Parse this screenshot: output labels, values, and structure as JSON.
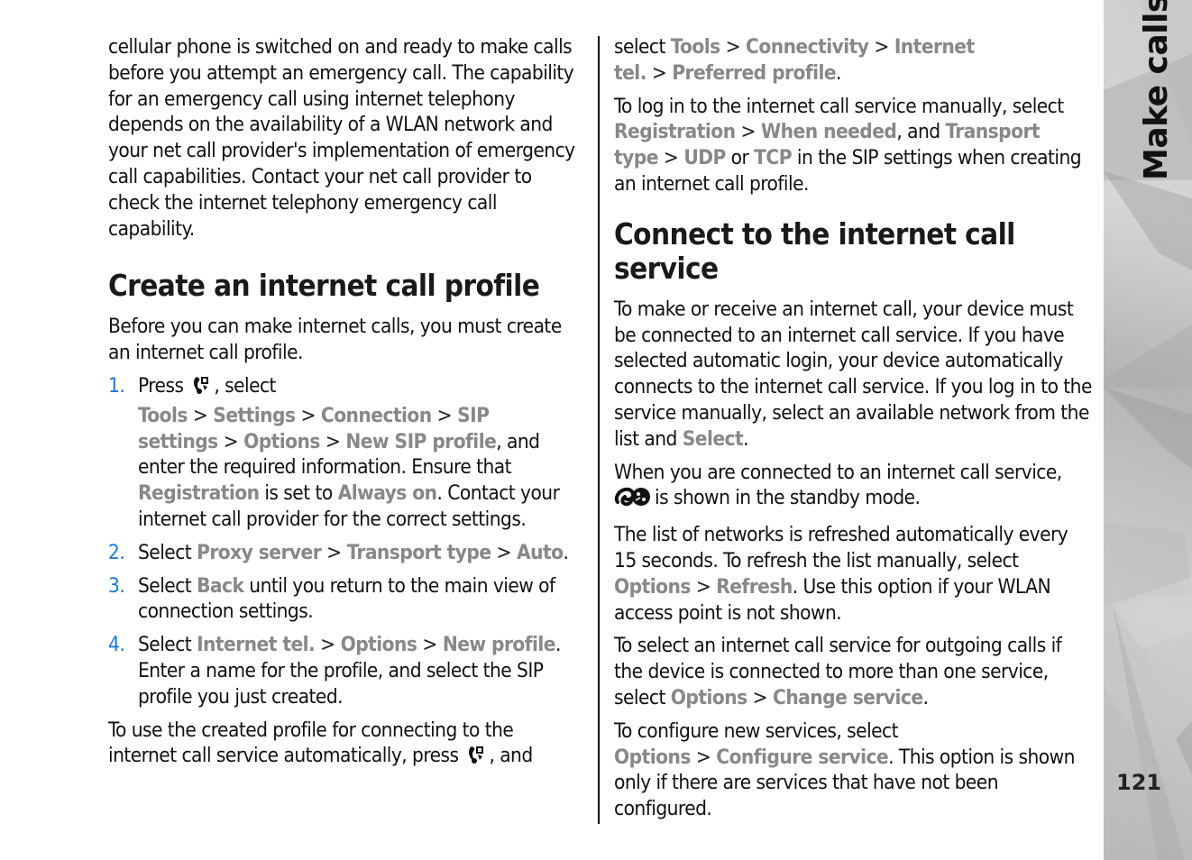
{
  "side_tab": {
    "title": "Make calls",
    "page_number": "121"
  },
  "left": {
    "intro": "cellular phone is switched on and ready to make calls before you attempt an emergency call. The capability for an emergency call using internet telephony depends on the availability of a WLAN network and your net call provider's implementation of emergency call capabilities. Contact your net call provider to check the internet telephony emergency call capability.",
    "heading": "Create an internet call profile",
    "lead": "Before you can make internet calls, you must create an internet call profile.",
    "steps": [
      {
        "num": "1.",
        "t1": "Press",
        "t2": ", select",
        "k1": "Tools",
        "k2": "Settings",
        "k3": "Connection",
        "k4": "SIP settings",
        "k5": "Options",
        "k6": "New SIP profile",
        "t3": ", and enter the required information. Ensure that",
        "k7": "Registration",
        "t4": "is set to",
        "k8": "Always on",
        "t5": ". Contact your internet call provider for the correct settings."
      },
      {
        "num": "2.",
        "t1": "Select",
        "k1": "Proxy server",
        "k2": "Transport type",
        "k3": "Auto",
        "t2": "."
      },
      {
        "num": "3.",
        "t1": "Select",
        "k1": "Back",
        "t2": "until you return to the main view of connection settings."
      },
      {
        "num": "4.",
        "t1": "Select",
        "k1": "Internet tel.",
        "k2": "Options",
        "k3": "New profile",
        "t2": ". Enter a name for the profile, and select the SIP profile you just created."
      }
    ],
    "outro_1": "To use the created profile for connecting to the internet call service automatically, press",
    "outro_2": ", and"
  },
  "right": {
    "p1": {
      "t1": "select",
      "k1": "Tools",
      "k2": "Connectivity",
      "k3": "Internet tel.",
      "k4": "Preferred profile",
      "t2": "."
    },
    "p2": {
      "t1": "To log in to the internet call service manually, select",
      "k1": "Registration",
      "k2": "When needed",
      "t2": ", and",
      "k3": "Transport type",
      "k4": "UDP",
      "t3": "or",
      "k5": "TCP",
      "t4": "in the SIP settings when creating an internet call profile."
    },
    "heading": "Connect to the internet call service",
    "p3": {
      "t1": "To make or receive an internet call, your device must be connected to an internet call service. If you have selected automatic login, your device automatically connects to the internet call service. If you log in to the service manually, select an available network from the list and",
      "k1": "Select",
      "t2": "."
    },
    "p4": {
      "t1": "When you are connected to an internet call service,",
      "t2": "is shown in the standby mode."
    },
    "p5": {
      "t1": "The list of networks is refreshed automatically every 15 seconds. To refresh the list manually, select",
      "k1": "Options",
      "k2": "Refresh",
      "t2": ". Use this option if your WLAN access point is not shown."
    },
    "p6": {
      "t1": "To select an internet call service for outgoing calls if the device is connected to more than one service, select",
      "k1": "Options",
      "k2": "Change service",
      "t2": "."
    },
    "p7": {
      "t1": "To configure new services, select",
      "k1": "Options",
      "k2": "Configure service",
      "t2": ". This option is shown only if there are services that have not been configured."
    }
  },
  "separator": ">",
  "icons": {
    "menu_key": "menu-key-icon",
    "internet_call": "internet-call-icon"
  },
  "colors": {
    "keyword": "#888888",
    "step_number": "#1a7ad8",
    "text": "#111111"
  }
}
